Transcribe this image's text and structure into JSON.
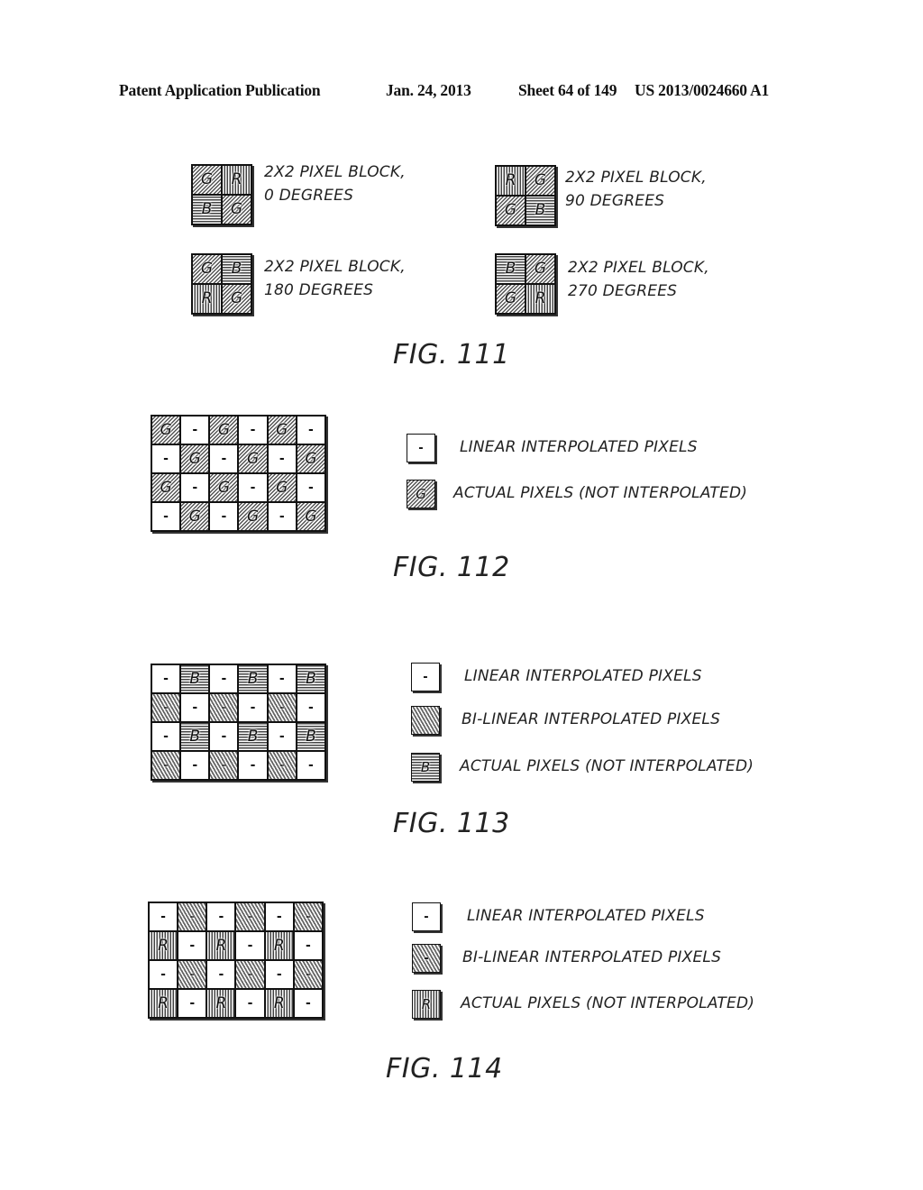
{
  "header": {
    "publication": "Patent Application Publication",
    "date": "Jan. 24, 2013",
    "sheet": "Sheet 64 of 149",
    "patent_number": "US 2013/0024660 A1"
  },
  "fig111": {
    "caption": "FIG. 111",
    "blocks": [
      {
        "cells": [
          [
            "G",
            "G"
          ],
          [
            "R",
            "R"
          ],
          [
            "B",
            "B"
          ],
          [
            "G",
            "G"
          ]
        ],
        "line1": "2X2 PIXEL BLOCK,",
        "line2": "0 DEGREES"
      },
      {
        "cells": [
          [
            "R",
            "R"
          ],
          [
            "G",
            "G"
          ],
          [
            "G",
            "G"
          ],
          [
            "B",
            "B"
          ]
        ],
        "line1": "2X2 PIXEL BLOCK,",
        "line2": "90 DEGREES"
      },
      {
        "cells": [
          [
            "G",
            "G"
          ],
          [
            "B",
            "B"
          ],
          [
            "R",
            "R"
          ],
          [
            "G",
            "G"
          ]
        ],
        "line1": "2X2 PIXEL BLOCK,",
        "line2": "180 DEGREES"
      },
      {
        "cells": [
          [
            "B",
            "B"
          ],
          [
            "G",
            "G"
          ],
          [
            "G",
            "G"
          ],
          [
            "R",
            "R"
          ]
        ],
        "line1": "2X2 PIXEL BLOCK,",
        "line2": "270 DEGREES"
      }
    ]
  },
  "fig112": {
    "caption": "FIG. 112",
    "grid": [
      [
        "G",
        "-",
        "G",
        "-",
        "G",
        "-"
      ],
      [
        "-",
        "G",
        "-",
        "G",
        "-",
        "G"
      ],
      [
        "G",
        "-",
        "G",
        "-",
        "G",
        "-"
      ],
      [
        "-",
        "G",
        "-",
        "G",
        "-",
        "G"
      ]
    ],
    "legend": [
      {
        "symbol": "-",
        "type": "linear",
        "label": "LINEAR INTERPOLATED PIXELS"
      },
      {
        "symbol": "G",
        "type": "G",
        "label": "ACTUAL PIXELS (NOT INTERPOLATED)"
      }
    ]
  },
  "fig113": {
    "caption": "FIG. 113",
    "grid": [
      [
        "-",
        "B",
        "-",
        "B",
        "-",
        "B"
      ],
      [
        "bi",
        "-",
        "bi",
        "-",
        "bi",
        "-"
      ],
      [
        "-",
        "B",
        "-",
        "B",
        "-",
        "B"
      ],
      [
        "bi",
        "-",
        "bi",
        "-",
        "bi",
        "-"
      ]
    ],
    "legend": [
      {
        "symbol": "-",
        "type": "linear",
        "label": "LINEAR INTERPOLATED PIXELS"
      },
      {
        "symbol": "",
        "type": "bi",
        "label": "BI-LINEAR INTERPOLATED PIXELS"
      },
      {
        "symbol": "B",
        "type": "B",
        "label": "ACTUAL PIXELS (NOT INTERPOLATED)"
      }
    ]
  },
  "fig114": {
    "caption": "FIG. 114",
    "grid": [
      [
        "-",
        "bi",
        "-",
        "bi",
        "-",
        "bi"
      ],
      [
        "R",
        "-",
        "R",
        "-",
        "R",
        "-"
      ],
      [
        "-",
        "bi",
        "-",
        "bi",
        "-",
        "bi"
      ],
      [
        "R",
        "-",
        "R",
        "-",
        "R",
        "-"
      ]
    ],
    "legend": [
      {
        "symbol": "-",
        "type": "linear",
        "label": "LINEAR INTERPOLATED PIXELS"
      },
      {
        "symbol": "-",
        "type": "bi",
        "label": "BI-LINEAR INTERPOLATED PIXELS"
      },
      {
        "symbol": "R",
        "type": "R",
        "label": "ACTUAL PIXELS (NOT INTERPOLATED)"
      }
    ]
  }
}
